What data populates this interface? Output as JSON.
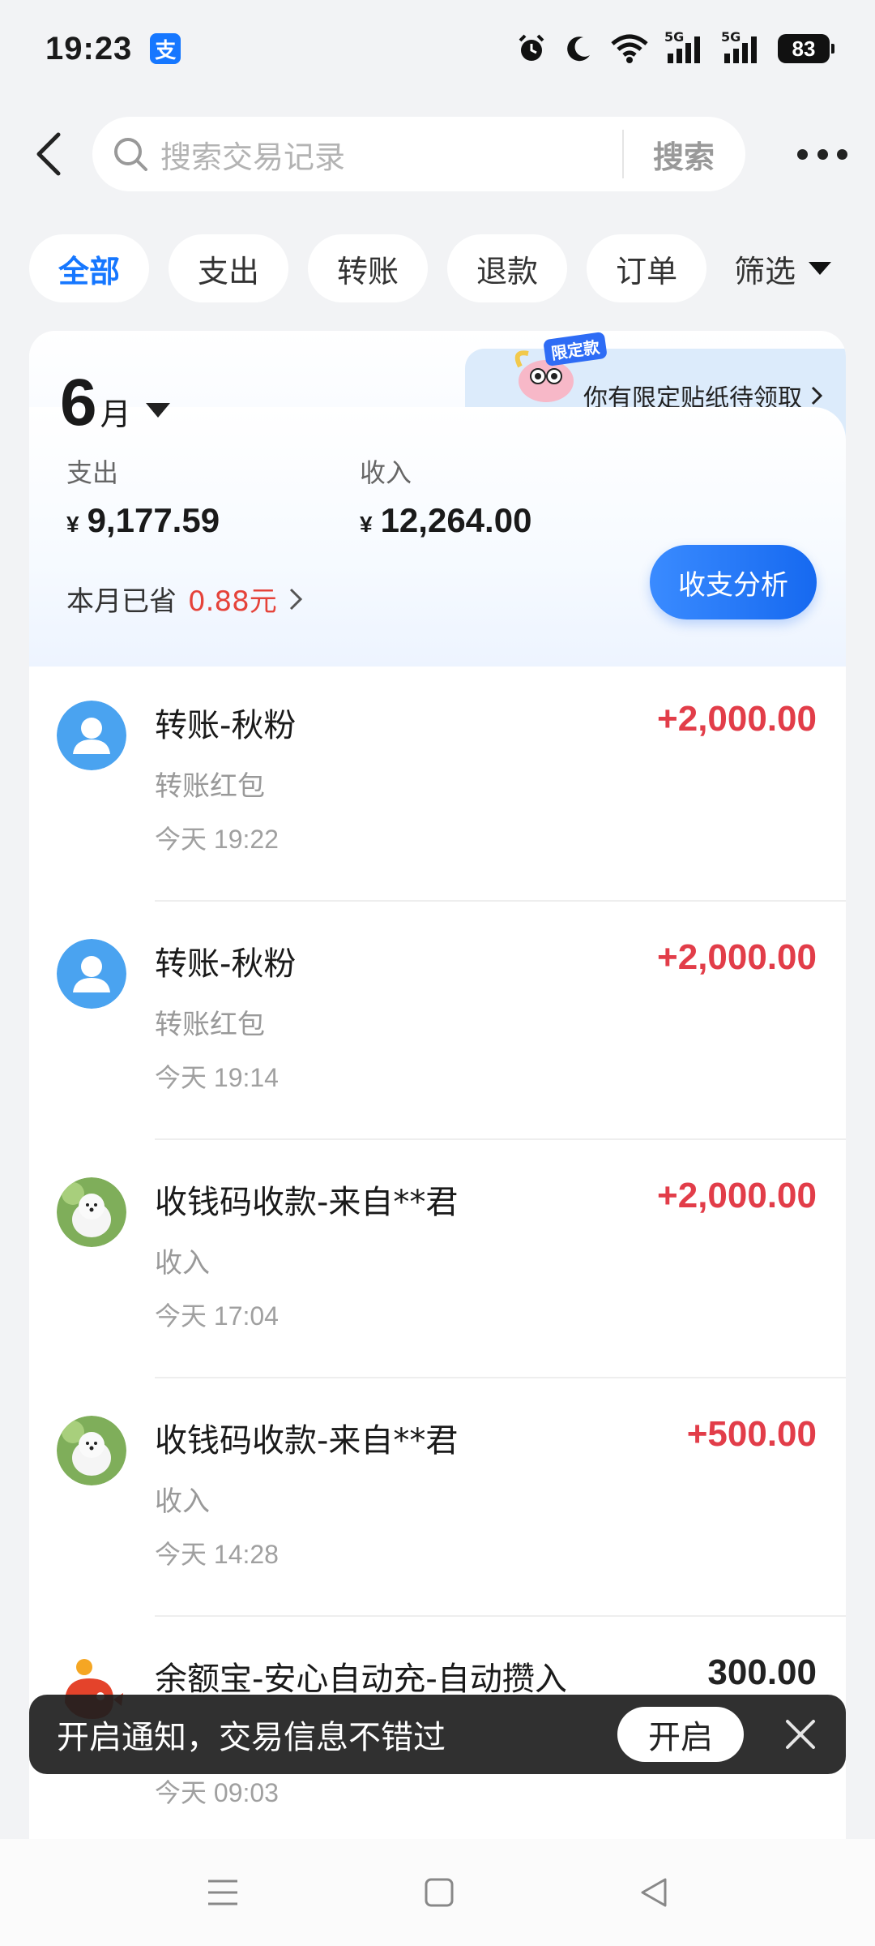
{
  "status_bar": {
    "time": "19:23",
    "app_badge": "支",
    "signal_labels": [
      "5G",
      "5G"
    ],
    "battery": "83"
  },
  "search": {
    "placeholder": "搜索交易记录",
    "button_label": "搜索"
  },
  "tabs": [
    {
      "label": "全部",
      "active": true
    },
    {
      "label": "支出",
      "active": false
    },
    {
      "label": "转账",
      "active": false
    },
    {
      "label": "退款",
      "active": false
    },
    {
      "label": "订单",
      "active": false
    },
    {
      "label": "筛选",
      "active": false
    }
  ],
  "summary": {
    "month_number": "6",
    "month_unit": "月",
    "promo_badge": "限定款",
    "promo_text": "你有限定贴纸待领取",
    "expense_label": "支出",
    "expense_currency": "¥",
    "expense_value": "9,177.59",
    "income_label": "收入",
    "income_currency": "¥",
    "income_value": "12,264.00",
    "saved_label": "本月已省",
    "saved_amount": "0.88元",
    "analysis_button": "收支分析"
  },
  "transactions": [
    {
      "title": "转账-秋粉",
      "subtitle": "转账红包",
      "time": "今天 19:22",
      "amount": "+2,000.00",
      "avatar": "person-avatar"
    },
    {
      "title": "转账-秋粉",
      "subtitle": "转账红包",
      "time": "今天 19:14",
      "amount": "+2,000.00",
      "avatar": "person-avatar"
    },
    {
      "title": "收钱码收款-来自**君",
      "subtitle": "收入",
      "time": "今天 17:04",
      "amount": "+2,000.00",
      "avatar": "dog-photo"
    },
    {
      "title": "收钱码收款-来自**君",
      "subtitle": "收入",
      "time": "今天 14:28",
      "amount": "+500.00",
      "avatar": "dog-photo"
    },
    {
      "title": "余额宝-安心自动充-自动攒入",
      "subtitle": "",
      "time": "今天 09:03",
      "amount": "300.00",
      "avatar": "yuebao-logo"
    }
  ],
  "toast": {
    "text": "开启通知，交易信息不错过",
    "button": "开启"
  },
  "colors": {
    "accent": "#1677ff",
    "income": "#e23d49",
    "saved": "#e5433a"
  }
}
